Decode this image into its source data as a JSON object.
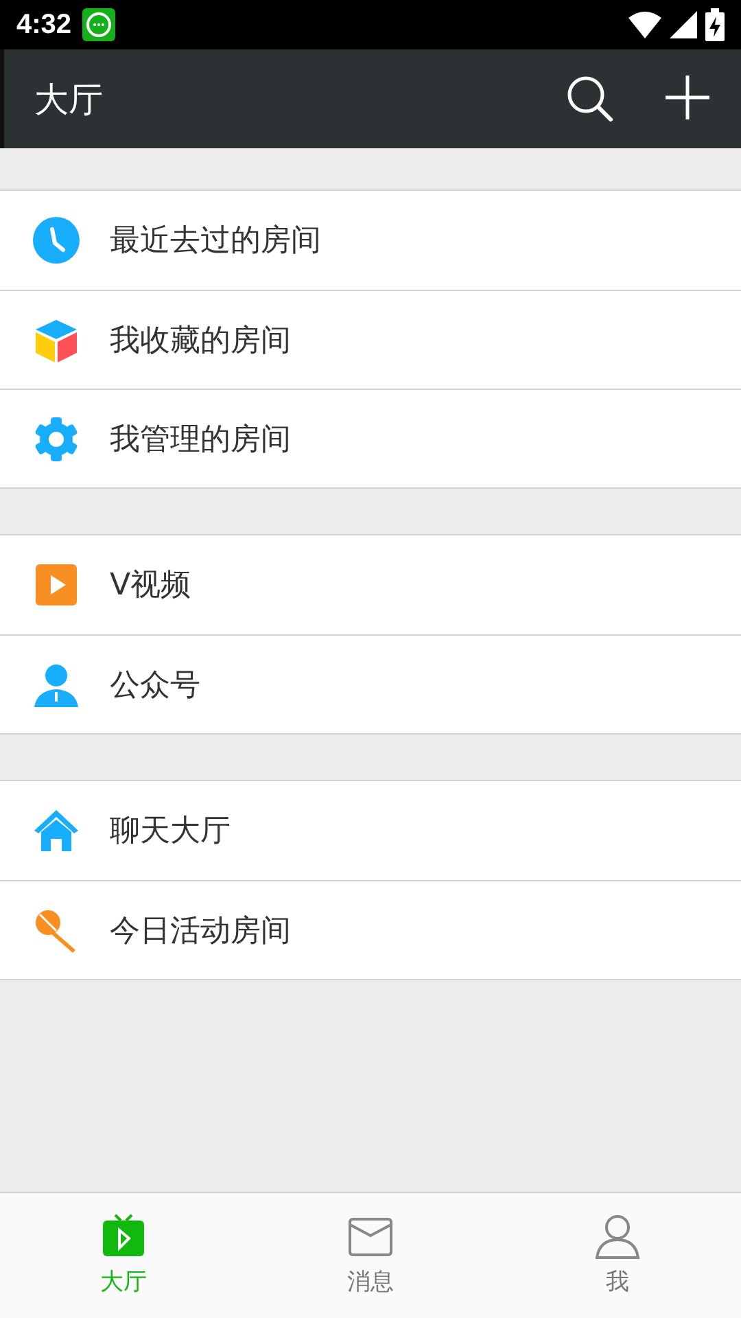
{
  "status_bar": {
    "time": "4:32"
  },
  "toolbar": {
    "title": "大厅"
  },
  "groups": [
    {
      "items": [
        {
          "label": "最近去过的房间"
        },
        {
          "label": "我收藏的房间"
        },
        {
          "label": "我管理的房间"
        }
      ]
    },
    {
      "items": [
        {
          "label": "V视频"
        },
        {
          "label": "公众号"
        }
      ]
    },
    {
      "items": [
        {
          "label": "聊天大厅"
        },
        {
          "label": "今日活动房间"
        }
      ]
    }
  ],
  "tabs": [
    {
      "label": "大厅",
      "selected": true
    },
    {
      "label": "消息",
      "selected": false
    },
    {
      "label": "我",
      "selected": false
    }
  ]
}
